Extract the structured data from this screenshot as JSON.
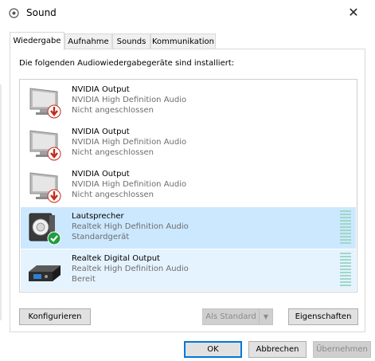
{
  "window": {
    "title": "Sound",
    "close_label": "✕"
  },
  "tabs": [
    {
      "label": "Wiedergabe",
      "active": true
    },
    {
      "label": "Aufnahme",
      "active": false
    },
    {
      "label": "Sounds",
      "active": false
    },
    {
      "label": "Kommunikation",
      "active": false
    }
  ],
  "heading": "Die folgenden Audiowiedergabegeräte sind installiert:",
  "devices": [
    {
      "name": "NVIDIA Output",
      "driver": "NVIDIA High Definition Audio",
      "status": "Nicht angeschlossen",
      "icon": "monitor-disconnected-icon"
    },
    {
      "name": "NVIDIA Output",
      "driver": "NVIDIA High Definition Audio",
      "status": "Nicht angeschlossen",
      "icon": "monitor-disconnected-icon"
    },
    {
      "name": "NVIDIA Output",
      "driver": "NVIDIA High Definition Audio",
      "status": "Nicht angeschlossen",
      "icon": "monitor-disconnected-icon"
    },
    {
      "name": "Lautsprecher",
      "driver": "Realtek High Definition Audio",
      "status": "Standardgerät",
      "icon": "speaker-default-icon"
    },
    {
      "name": "Realtek Digital Output",
      "driver": "Realtek High Definition Audio",
      "status": "Bereit",
      "icon": "digital-output-icon"
    }
  ],
  "buttons": {
    "configure": "Konfigurieren",
    "set_default": "Als Standard",
    "properties": "Eigenschaften",
    "ok": "OK",
    "cancel": "Abbrechen",
    "apply": "Übernehmen"
  },
  "colors": {
    "selected_bg": "#cce8ff",
    "hover_bg": "#e5f3ff",
    "default_check": "#1e9e3f",
    "disconnected_arrow": "#c42b1c"
  }
}
